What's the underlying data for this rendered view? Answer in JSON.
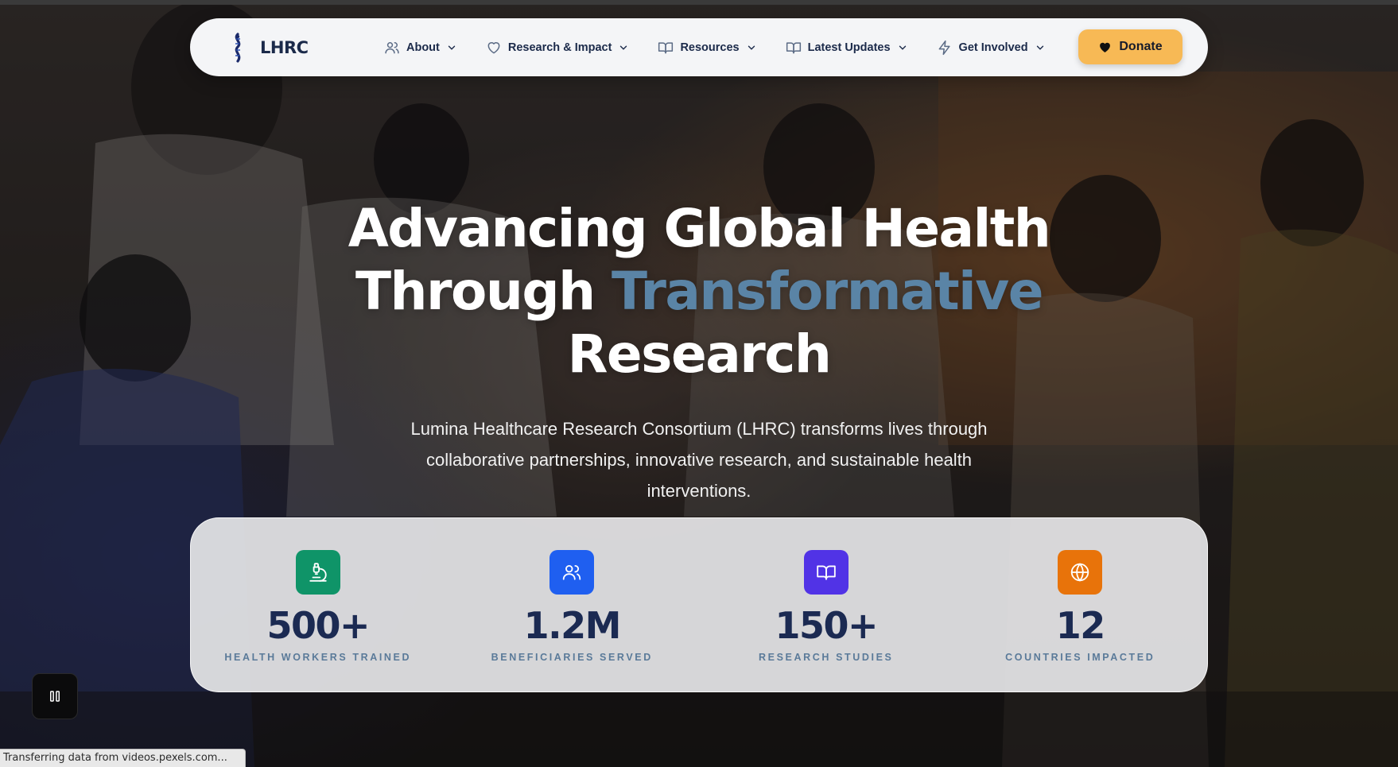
{
  "brand": {
    "name": "LHRC",
    "accent_color": "#f7b955",
    "primary_color": "#1b2a4a"
  },
  "nav": {
    "items": [
      {
        "label": "About",
        "icon": "users-icon"
      },
      {
        "label": "Research & Impact",
        "icon": "heart-icon"
      },
      {
        "label": "Resources",
        "icon": "book-open-icon"
      },
      {
        "label": "Latest Updates",
        "icon": "book-open-icon"
      },
      {
        "label": "Get Involved",
        "icon": "lightning-icon"
      }
    ],
    "donate_label": "Donate"
  },
  "hero": {
    "title_line1": "Advancing Global Health",
    "title_line2_prefix": "Through ",
    "title_line2_accent": "Transformative",
    "title_line3": "Research",
    "subtitle": "Lumina Healthcare Research Consortium (LHRC) transforms lives through collaborative partnerships, innovative research, and sustainable health interventions."
  },
  "stats": [
    {
      "value": "500+",
      "label": "HEALTH WORKERS TRAINED",
      "icon": "microscope-icon",
      "color": "#0f9468"
    },
    {
      "value": "1.2M",
      "label": "BENEFICIARIES SERVED",
      "icon": "users-icon",
      "color": "#1f5ff0"
    },
    {
      "value": "150+",
      "label": "RESEARCH STUDIES",
      "icon": "book-open-icon",
      "color": "#5133e6"
    },
    {
      "value": "12",
      "label": "COUNTRIES IMPACTED",
      "icon": "globe-icon",
      "color": "#e8730a"
    }
  ],
  "video_control": {
    "icon": "pause-icon"
  },
  "status_bar": {
    "text": "Transferring data from videos.pexels.com..."
  }
}
